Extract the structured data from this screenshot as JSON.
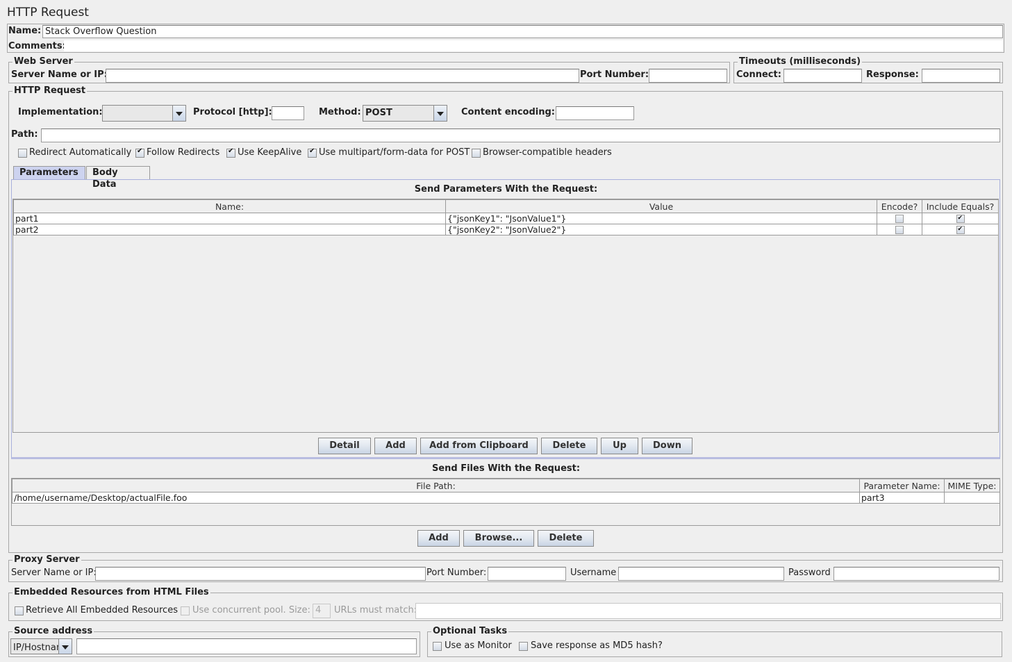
{
  "window": {
    "title": "HTTP Request"
  },
  "name_field": {
    "label": "Name:",
    "value": "Stack Overflow Question"
  },
  "comments_field": {
    "label": "Comments:",
    "value": ""
  },
  "web_server": {
    "legend": "Web Server",
    "server_label": "Server Name or IP:",
    "server_value": "",
    "port_label": "Port Number:",
    "port_value": ""
  },
  "timeouts": {
    "legend": "Timeouts (milliseconds)",
    "connect_label": "Connect:",
    "connect_value": "",
    "response_label": "Response:",
    "response_value": ""
  },
  "http_request": {
    "legend": "HTTP Request",
    "implementation_label": "Implementation:",
    "implementation_value": "",
    "protocol_label": "Protocol [http]:",
    "protocol_value": "",
    "method_label": "Method:",
    "method_value": "POST",
    "encoding_label": "Content encoding:",
    "encoding_value": "",
    "path_label": "Path:",
    "path_value": "",
    "options": [
      {
        "label": "Redirect Automatically",
        "checked": false
      },
      {
        "label": "Follow Redirects",
        "checked": true
      },
      {
        "label": "Use KeepAlive",
        "checked": true
      },
      {
        "label": "Use multipart/form-data for POST",
        "checked": true
      },
      {
        "label": "Browser-compatible headers",
        "checked": false
      }
    ]
  },
  "tabs": [
    {
      "label": "Parameters",
      "active": true
    },
    {
      "label": "Body Data",
      "active": false
    }
  ],
  "parameters": {
    "title": "Send Parameters With the Request:",
    "columns": [
      "Name:",
      "Value",
      "Encode?",
      "Include Equals?"
    ],
    "rows": [
      {
        "name": "part1",
        "value": "{\"jsonKey1\": \"JsonValue1\"}",
        "encode": false,
        "include_equals": true
      },
      {
        "name": "part2",
        "value": "{\"jsonKey2\": \"JsonValue2\"}",
        "encode": false,
        "include_equals": true
      }
    ],
    "buttons": [
      "Detail",
      "Add",
      "Add from Clipboard",
      "Delete",
      "Up",
      "Down"
    ]
  },
  "files": {
    "title": "Send Files With the Request:",
    "columns": [
      "File Path:",
      "Parameter Name:",
      "MIME Type:"
    ],
    "rows": [
      {
        "path": "/home/username/Desktop/actualFile.foo",
        "param": "part3",
        "mime": ""
      }
    ],
    "buttons": [
      "Add",
      "Browse...",
      "Delete"
    ]
  },
  "proxy": {
    "legend": "Proxy Server",
    "server_label": "Server Name or IP:",
    "server_value": "",
    "port_label": "Port Number:",
    "port_value": "",
    "username_label": "Username",
    "username_value": "",
    "password_label": "Password",
    "password_value": ""
  },
  "embedded": {
    "legend": "Embedded Resources from HTML Files",
    "retrieve_label": "Retrieve All Embedded Resources",
    "retrieve_checked": false,
    "concurrent_label": "Use concurrent pool. Size:",
    "concurrent_checked": false,
    "pool_size": "4",
    "urls_label": "URLs must match:",
    "urls_value": ""
  },
  "source_address": {
    "legend": "Source address",
    "type_value": "IP/Hostname",
    "address_value": ""
  },
  "optional_tasks": {
    "legend": "Optional Tasks",
    "monitor_label": "Use as Monitor",
    "monitor_checked": false,
    "md5_label": "Save response as MD5 hash?",
    "md5_checked": false
  }
}
